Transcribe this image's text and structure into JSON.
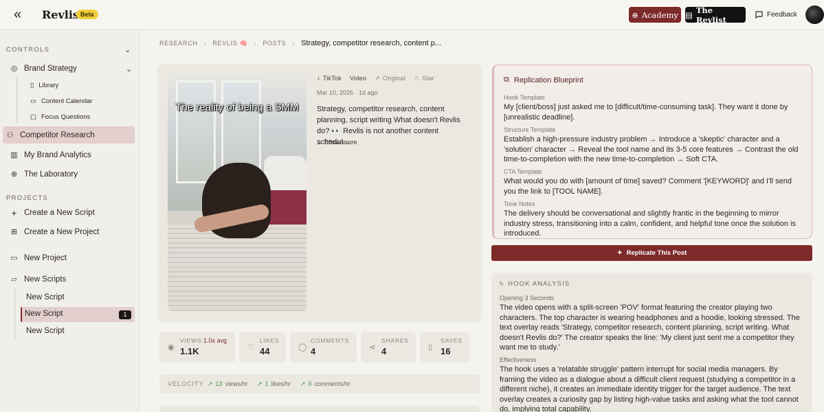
{
  "topbar": {
    "brand": "Revlis",
    "beta": "Beta",
    "academy": "Academy",
    "revlist": "The Revlist",
    "feedback": "Feedback"
  },
  "sidebar": {
    "controls_label": "CONTROLS",
    "brand_strategy": "Brand Strategy",
    "sub_items": [
      "Library",
      "Content Calendar",
      "Focus Questions"
    ],
    "competitor_research": "Competitor Research",
    "my_brand_analytics": "My Brand Analytics",
    "laboratory": "The Laboratory",
    "projects_label": "PROJECTS",
    "create_script": "Create a New Script",
    "create_project": "Create a New Project",
    "new_project": "New Project",
    "new_scripts": "New Scripts",
    "scripts": [
      "New Script",
      "New Script",
      "New Script"
    ],
    "active_count": "1"
  },
  "breadcrumb": {
    "items": [
      "RESEARCH",
      "REVLIS 🧠",
      "POSTS"
    ],
    "current": "Strategy, competitor research, content p..."
  },
  "post": {
    "platform": "TikTok",
    "type": "Video",
    "original": "Original",
    "star": "Star",
    "date": "Mar 10, 2026 · 1d ago",
    "description": "Strategy, competitor research, content planning, script writing What doesn't Revlis do? 👀 Revlis is not another content schedul...",
    "show_more": "Show more",
    "thumbnail_caption": "The reality of being a SMM"
  },
  "stats": {
    "views_label": "VIEWS",
    "views_avg": "1.0x avg",
    "views": "1.1K",
    "likes_label": "LIKES",
    "likes": "44",
    "comments_label": "COMMENTS",
    "comments": "4",
    "shares_label": "SHARES",
    "shares": "4",
    "saves_label": "SAVES",
    "saves": "16"
  },
  "velocity": {
    "label": "VELOCITY",
    "views": "13",
    "views_unit": "views/hr",
    "likes": "1",
    "likes_unit": "likes/hr",
    "comments": "0",
    "comments_unit": "comments/hr"
  },
  "blueprint": {
    "title": "Replication Blueprint",
    "hook_label": "Hook Template",
    "hook": "My [client/boss] just asked me to [difficult/time-consuming task]. They want it done by [unrealistic deadline].",
    "structure_label": "Structure Template",
    "structure": "Establish a high-pressure industry problem → Introduce a 'skeptic' character and a 'solution' character → Reveal the tool name and its 3-5 core features → Contrast the old time-to-completion with the new time-to-completion → Soft CTA.",
    "cta_label": "CTA Template",
    "cta": "What would you do with [amount of time] saved? Comment '[KEYWORD]' and I'll send you the link to [TOOL NAME].",
    "tone_label": "Tone Notes",
    "tone": "The delivery should be conversational and slightly frantic in the beginning to mirror industry stress, transitioning into a calm, confident, and helpful tone once the solution is introduced."
  },
  "replicate_button": "Replicate This Post",
  "hook_analysis": {
    "title": "HOOK ANALYSIS",
    "opening_label": "Opening 3 Seconds",
    "opening": "The video opens with a split-screen 'POV' format featuring the creator playing two characters. The top character is wearing headphones and a hoodie, looking stressed. The text overlay reads 'Strategy, competitor research, content planning, script writing. What doesn't Revlis do?' The creator speaks the line: 'My client just sent me a competitor they want me to study.'",
    "effectiveness_label": "Effectiveness",
    "effectiveness": "The hook uses a 'relatable struggle' pattern interrupt for social media managers. By framing the video as a dialogue about a difficult client request (studying a competitor in a different niche), it creates an immediate identity trigger for the target audience. The text overlay creates a curiosity gap by listing high-value tasks and asking what the tool cannot do, implying total capability."
  },
  "colors": {
    "accent": "#7d2a2a",
    "badge": "#f1cf3b",
    "growth": "#3a9a4a"
  }
}
